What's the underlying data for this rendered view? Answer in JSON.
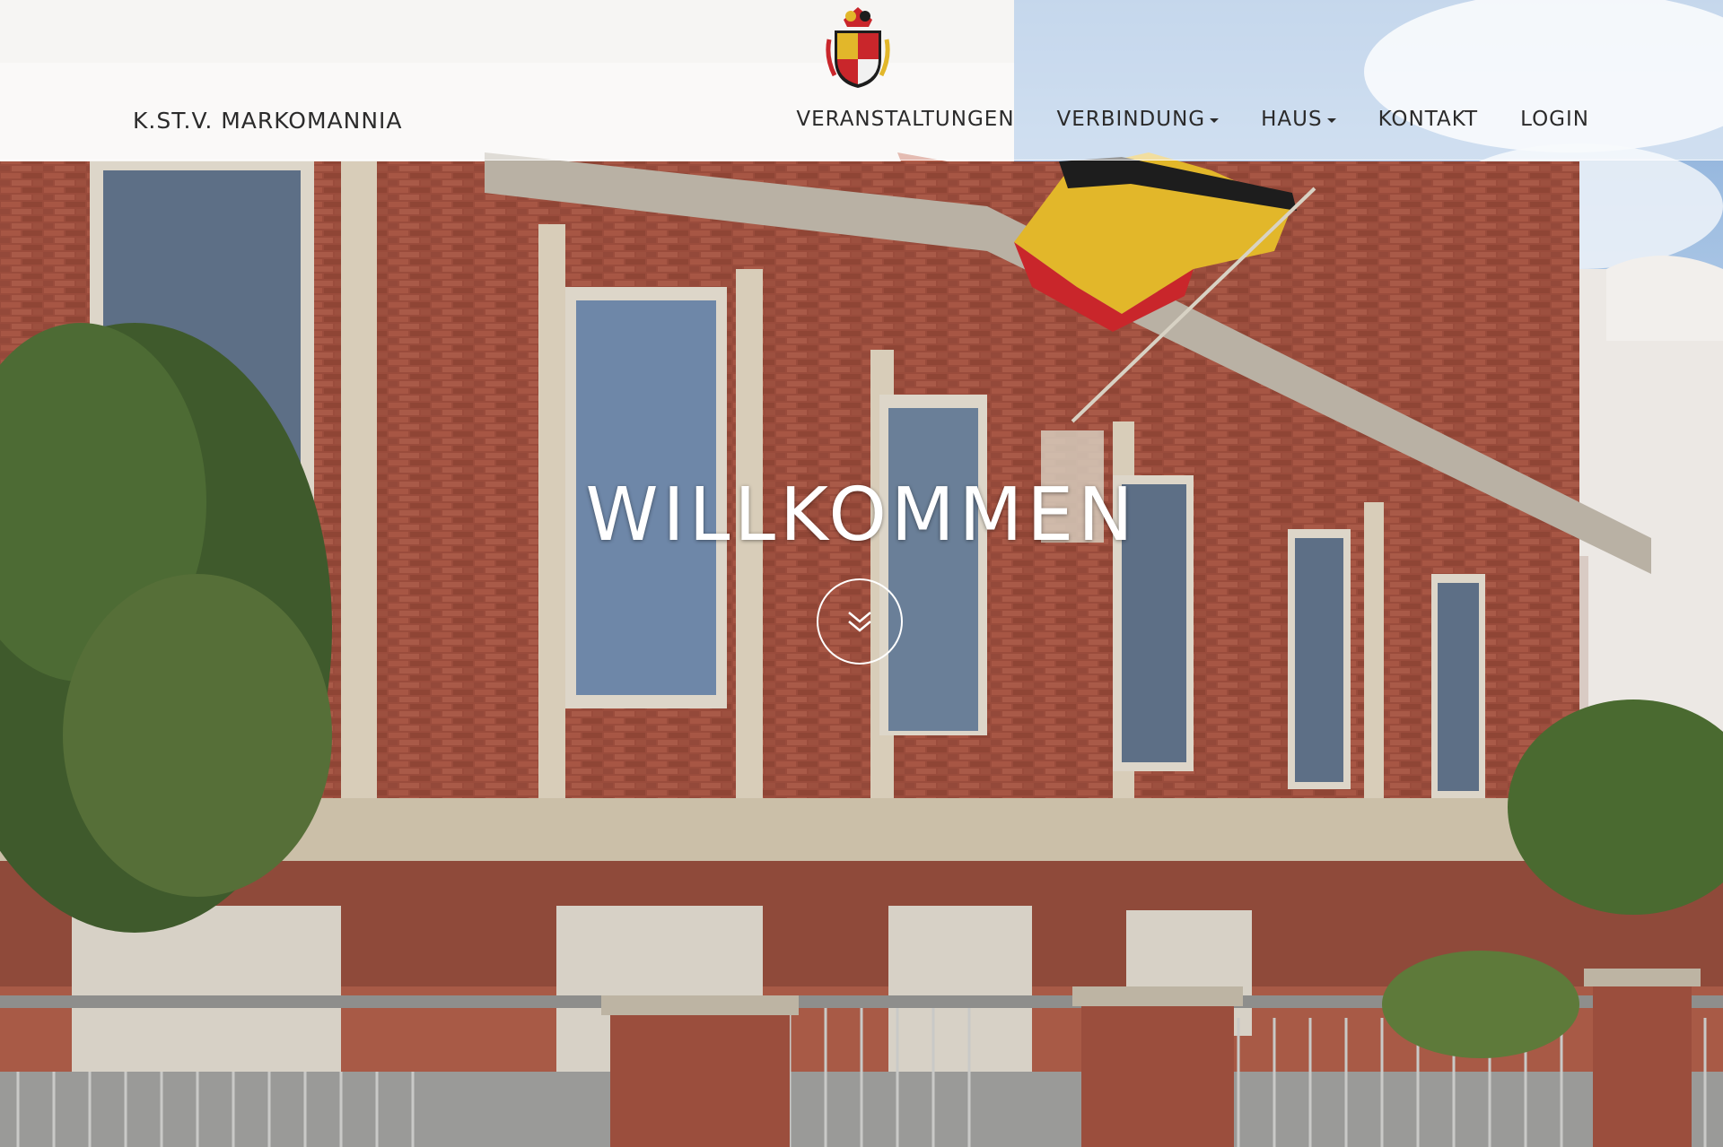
{
  "navbar": {
    "brand": "K.ST.V. MARKOMANNIA",
    "menu": [
      {
        "label": "VERANSTALTUNGEN",
        "dropdown": false
      },
      {
        "label": "VERBINDUNG",
        "dropdown": true
      },
      {
        "label": "HAUS",
        "dropdown": true
      },
      {
        "label": "KONTAKT",
        "dropdown": false
      },
      {
        "label": "LOGIN",
        "dropdown": false
      }
    ]
  },
  "hero": {
    "title": "WILLKOMMEN",
    "scroll_icon": "double-chevron-down-icon",
    "background": "house-facade-photo"
  },
  "colors": {
    "nav_text": "#2b2b2b",
    "hero_text": "#ffffff",
    "brick": "#9c4d3d",
    "sky": "#9fbfe0"
  }
}
